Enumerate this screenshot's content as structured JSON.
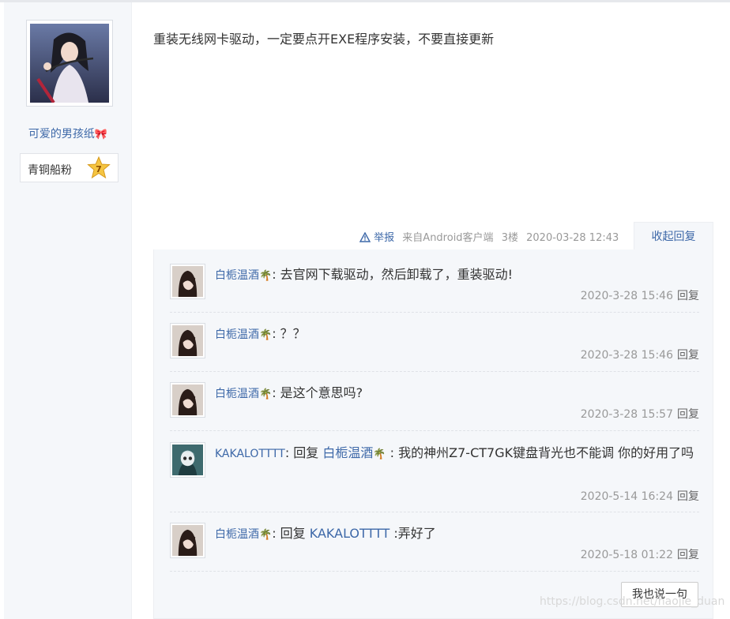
{
  "author": {
    "name": "可爱的男孩纸",
    "name_emoji": "🎀",
    "rank_label": "青铜船粉",
    "rank_level": "7"
  },
  "post": {
    "content": "重装无线网卡驱动，一定要点开EXE程序安装，不要直接更新",
    "report_label": "举报",
    "source": "来自Android客户端",
    "floor": "3楼",
    "datetime": "2020-03-28 12:43",
    "collapse_label": "收起回复"
  },
  "replies": [
    {
      "user": "白栀温酒",
      "user_emoji": "🌴",
      "sep": ": ",
      "content": "去官网下载驱动，然后卸载了，重装驱动!",
      "time": "2020-3-28 15:46",
      "reply_label": "回复"
    },
    {
      "user": "白栀温酒",
      "user_emoji": "🌴",
      "sep": ": ",
      "content": "？？",
      "time": "2020-3-28 15:46",
      "reply_label": "回复"
    },
    {
      "user": "白栀温酒",
      "user_emoji": "🌴",
      "sep": ": ",
      "content": "是这个意思吗?",
      "time": "2020-3-28 15:57",
      "reply_label": "回复"
    },
    {
      "user": "KAKALOTTTT",
      "sep": ": ",
      "prefix": "回复 ",
      "mention": "白栀温酒",
      "mention_emoji": "🌴",
      "content": " : 我的神州Z7-CT7GK键盘背光也不能调 你的好用了吗",
      "time": "2020-5-14 16:24",
      "reply_label": "回复"
    },
    {
      "user": "白栀温酒",
      "user_emoji": "🌴",
      "sep": ": ",
      "prefix": "回复 ",
      "mention": "KAKALOTTTT",
      "content": " :弄好了",
      "time": "2020-5-18 01:22",
      "reply_label": "回复"
    }
  ],
  "say_button": "我也说一句",
  "watermark": "https://blog.csdn.net/haojie_duan",
  "colors": {
    "link": "#3d68a8",
    "reply_bg": "#f5f7fa",
    "meta": "#999999"
  }
}
